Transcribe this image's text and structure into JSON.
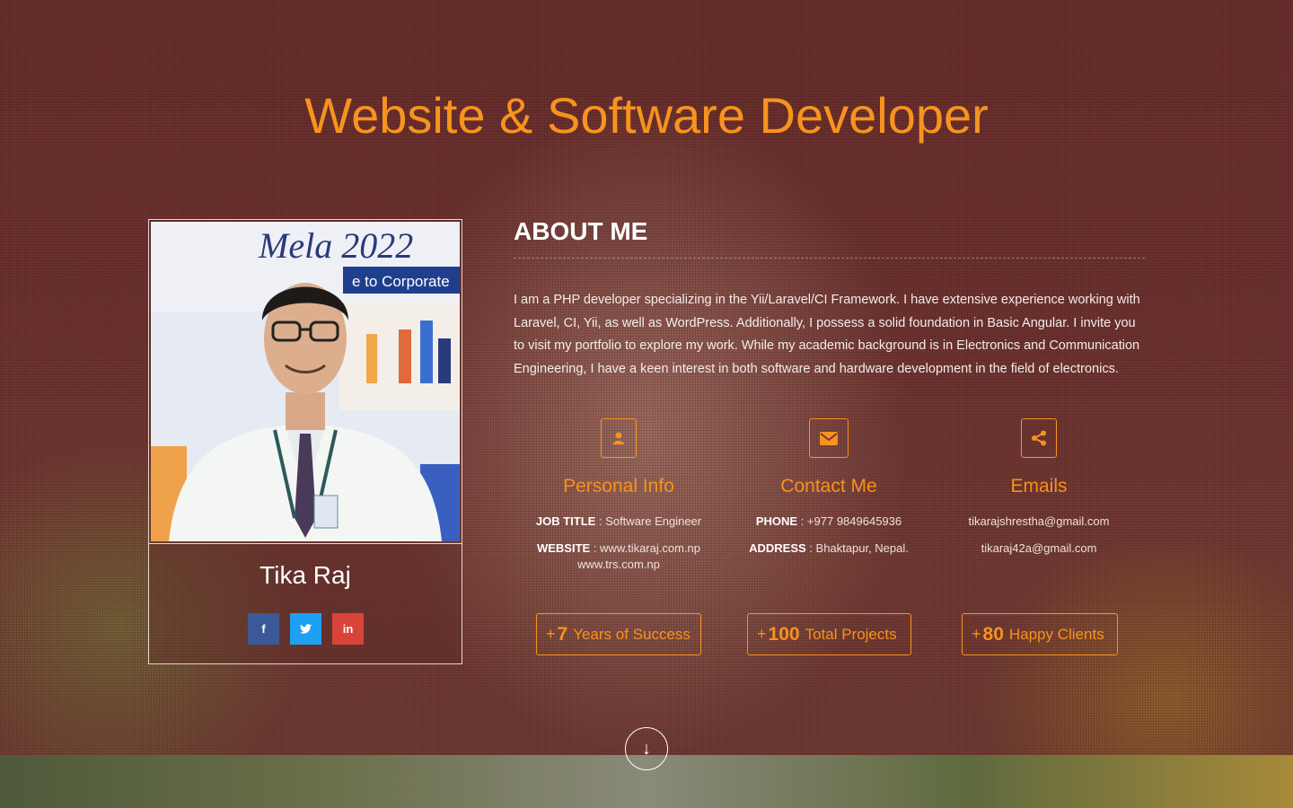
{
  "hero": {
    "title": "Website & Software Developer"
  },
  "profile": {
    "name": "Tika Raj",
    "banner_text": "Mela 2022",
    "banner_sub": "e to Corporate",
    "socials": [
      {
        "icon": "facebook-icon",
        "glyph": "f"
      },
      {
        "icon": "twitter-icon",
        "glyph": "t"
      },
      {
        "icon": "linkedin-icon",
        "glyph": "in"
      }
    ]
  },
  "about": {
    "heading": "ABOUT ME",
    "text": "I am a PHP developer specializing in the Yii/Laravel/CI Framework. I have extensive experience working with Laravel, CI, Yii, as well as WordPress. Additionally, I possess a solid foundation in Basic Angular. I invite you to visit my portfolio to explore my work. While my academic background is in Electronics and Communication Engineering, I have a keen interest in both software and hardware development in the field of electronics."
  },
  "columns": {
    "personal": {
      "title": "Personal Info",
      "job_label": "JOB TITLE",
      "job_value": " : Software Engineer",
      "website_label": "WEBSITE",
      "website_value": " : www.tikaraj.com.np",
      "website_value2": "www.trs.com.np"
    },
    "contact": {
      "title": "Contact Me",
      "phone_label": "PHONE",
      "phone_value": " : +977 9849645936",
      "address_label": "ADDRESS",
      "address_value": " : Bhaktapur, Nepal."
    },
    "emails": {
      "title": "Emails",
      "email1": "tikarajshrestha@gmail.com",
      "email2": "tikaraj42a@gmail.com"
    }
  },
  "stats": [
    {
      "plus": "+",
      "num": "7",
      "label": "Years of Success"
    },
    {
      "plus": "+",
      "num": "100",
      "label": "Total Projects"
    },
    {
      "plus": "+",
      "num": "80",
      "label": "Happy Clients"
    }
  ],
  "scroll": {
    "glyph": "↓"
  },
  "colors": {
    "accent": "#f7931e",
    "facebook": "#3b5998",
    "twitter": "#1da1f2",
    "linkedin": "#d9443a"
  }
}
